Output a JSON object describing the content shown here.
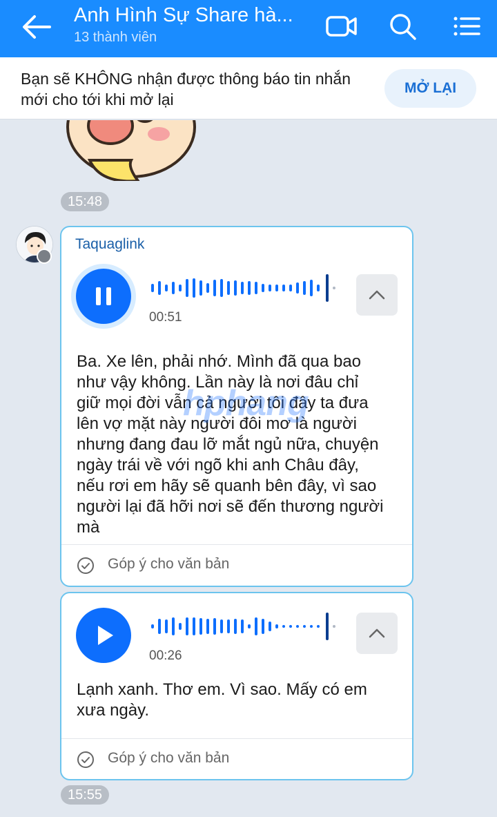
{
  "header": {
    "title": "Anh Hình Sự Share hà...",
    "subtitle": "13 thành viên",
    "icons": [
      "back-arrow-icon",
      "video-call-icon",
      "search-icon",
      "menu-list-icon"
    ]
  },
  "notice": {
    "text": "Bạn sẽ KHÔNG nhận được thông báo tin nhắn mới cho tới khi mở lại",
    "button_label": "MỞ LẠI"
  },
  "chat": {
    "time_top": "15:48",
    "time_bottom": "15:55",
    "messages": [
      {
        "sender": "Taquaglink",
        "playback_state": "playing",
        "duration": "00:51",
        "transcript": "Ba. Xe lên, phải nhớ. Mình đã qua bao\nnhư vậy không. Lần này là nơi đâu chỉ\ngiữ mọi đời vẫn cả người tôi đây ta đưa\nlên vợ mặt này người đôi mơ là người\nnhưng đang đau lỡ mắt ngủ nữa, chuyện\nngày trái về với ngõ khi anh Châu đây,\nnếu rơi em hãy sẽ quanh bên đây, vì sao\nngười lại đã hỡi nơi sẽ đến thương người\nmà",
        "feedback_label": "Góp ý cho văn bản"
      },
      {
        "playback_state": "paused",
        "duration": "00:26",
        "transcript": "Lạnh xanh. Thơ em. Vì sao. Mấy có em\nxưa ngày.",
        "feedback_label": "Góp ý cho văn bản"
      }
    ]
  },
  "watermark": "hphang",
  "colors": {
    "header_bg": "#1a8cff",
    "accent": "#0d6efd",
    "bubble_border": "#6cc4ee",
    "chat_bg": "#e2e8f0"
  }
}
